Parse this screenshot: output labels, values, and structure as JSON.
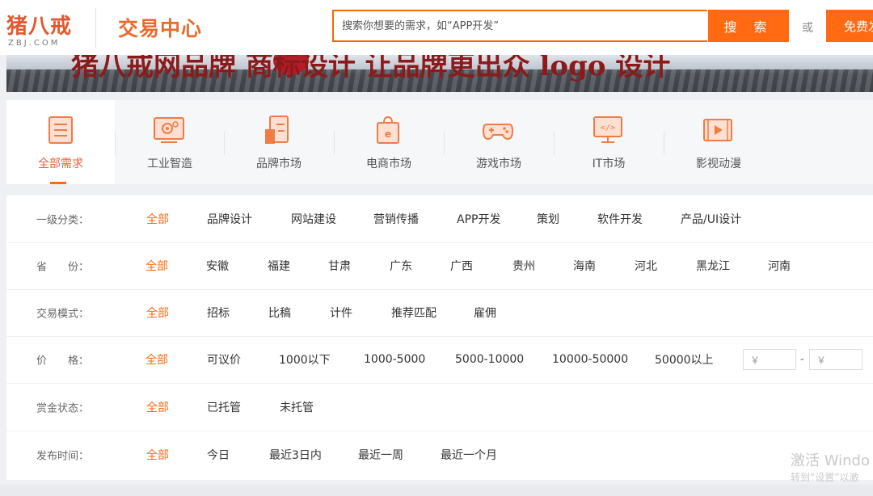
{
  "header": {
    "logo_main": "猪八戒",
    "logo_sub": "ZBJ.COM",
    "center_title": "交易中心",
    "search_placeholder": "搜索你想要的需求，如“APP开发”",
    "search_button": "搜 索",
    "or_text": "或",
    "free_button": "免费发"
  },
  "banner": {
    "text": "猪八戒网品牌 商标设计 让品牌更出众 logo 设计"
  },
  "tabs": [
    {
      "label": "全部需求",
      "icon": "list-icon",
      "active": true
    },
    {
      "label": "工业智造",
      "icon": "gear-icon",
      "active": false
    },
    {
      "label": "品牌市场",
      "icon": "brand-icon",
      "active": false
    },
    {
      "label": "电商市场",
      "icon": "shopping-bag-icon",
      "active": false
    },
    {
      "label": "游戏市场",
      "icon": "gamepad-icon",
      "active": false
    },
    {
      "label": "IT市场",
      "icon": "code-monitor-icon",
      "active": false
    },
    {
      "label": "影视动漫",
      "icon": "video-play-icon",
      "active": false
    }
  ],
  "filters": [
    {
      "label": "一级分类：",
      "options": [
        "全部",
        "品牌设计",
        "网站建设",
        "营销传播",
        "APP开发",
        "策划",
        "软件开发",
        "产品/UI设计"
      ]
    },
    {
      "label": "省　　份：",
      "options": [
        "全部",
        "安徽",
        "福建",
        "甘肃",
        "广东",
        "广西",
        "贵州",
        "海南",
        "河北",
        "黑龙江",
        "河南"
      ]
    },
    {
      "label": "交易模式：",
      "options": [
        "全部",
        "招标",
        "比稿",
        "计件",
        "推荐匹配",
        "雇佣"
      ]
    },
    {
      "label": "价　　格：",
      "options": [
        "全部",
        "可议价",
        "1000以下",
        "1000-5000",
        "5000-10000",
        "10000-50000",
        "50000以上"
      ],
      "price_min_placeholder": "￥",
      "price_dash": "-",
      "price_max_placeholder": "￥"
    },
    {
      "label": "赏金状态：",
      "options": [
        "全部",
        "已托管",
        "未托管"
      ]
    },
    {
      "label": "发布时间：",
      "options": [
        "全部",
        "今日",
        "最近3日内",
        "最近一周",
        "最近一个月"
      ]
    }
  ],
  "watermark": {
    "line1": "激活 Windo",
    "line2": "转到“设置”以激"
  },
  "colors": {
    "accent": "#ff6a13",
    "title": "#e86a2c"
  }
}
